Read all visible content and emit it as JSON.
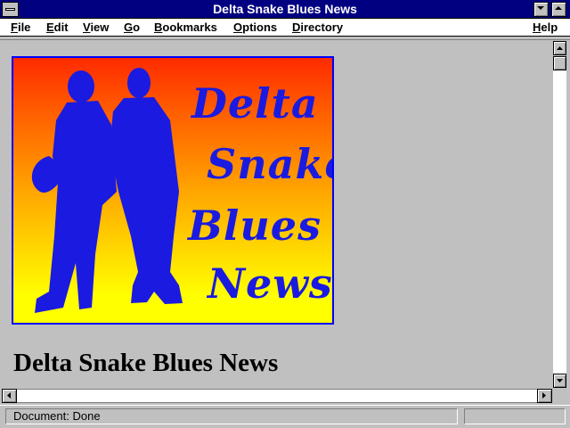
{
  "window": {
    "title": "Delta Snake Blues News"
  },
  "menu": {
    "file": "File",
    "edit": "Edit",
    "view": "View",
    "go": "Go",
    "bookmarks": "Bookmarks",
    "options": "Options",
    "directory": "Directory",
    "help": "Help"
  },
  "logo": {
    "line1": "Delta",
    "line2": "Snake",
    "line3": "Blues",
    "line4": "News"
  },
  "page": {
    "heading": "Delta Snake Blues News"
  },
  "status": {
    "text": "Document: Done"
  },
  "colors": {
    "titlebar": "#000080",
    "logo_text": "#1a1ae0",
    "logo_border": "#0000ff"
  }
}
